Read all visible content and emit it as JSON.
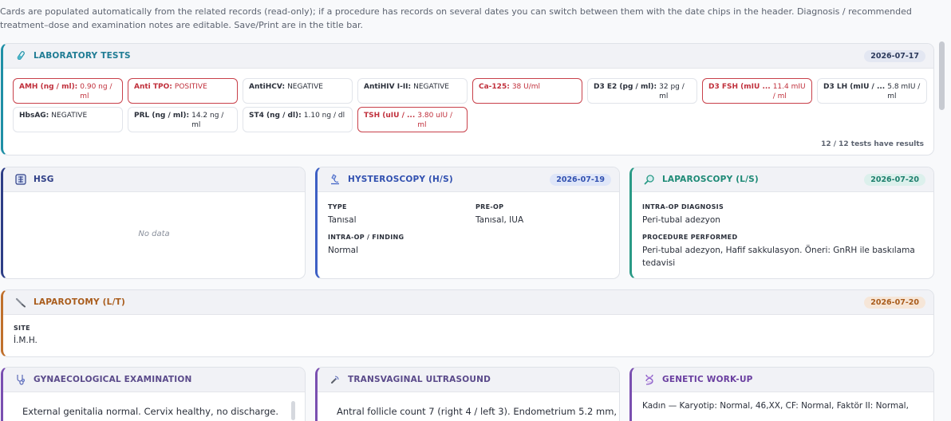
{
  "notice": "Cards are populated automatically from the related records (read-only); if a procedure has records on several dates you can switch between them with the date chips in the header. Diagnosis / recommended treatment–dose and examination notes are editable. Save/Print are in the title bar.",
  "lab": {
    "title": "LABORATORY TESTS",
    "icon": "test-tube-icon",
    "date": "2026-07-17",
    "count_text": "12 / 12 tests have results",
    "tests": [
      {
        "name": "AMH (ng / ml):",
        "value": "0.90 ng / ml",
        "abnormal": true
      },
      {
        "name": "Anti TPO:",
        "value": "POSITIVE",
        "abnormal": true
      },
      {
        "name": "AntiHCV:",
        "value": "NEGATIVE",
        "abnormal": false
      },
      {
        "name": "AntiHIV I-II:",
        "value": "NEGATIVE",
        "abnormal": false
      },
      {
        "name": "Ca-125:",
        "value": "38 U/ml",
        "abnormal": true
      },
      {
        "name": "D3 E2 (pg / ml):",
        "value": "32 pg / ml",
        "abnormal": false
      },
      {
        "name": "D3 FSH (mIU ...",
        "value": "11.4 mIU / ml",
        "abnormal": true
      },
      {
        "name": "D3 LH (mIU / ...",
        "value": "5.8 mIU / ml",
        "abnormal": false
      },
      {
        "name": "HbsAG:",
        "value": "NEGATIVE",
        "abnormal": false
      },
      {
        "name": "PRL (ng / ml):",
        "value": "14.2 ng / ml",
        "abnormal": false
      },
      {
        "name": "ST4 (ng / dl):",
        "value": "1.10 ng / dl",
        "abnormal": false
      },
      {
        "name": "TSH (uIU / ...",
        "value": "3.80 uIU / ml",
        "abnormal": true
      }
    ]
  },
  "hsg": {
    "title": "HSG",
    "icon": "xray-icon",
    "empty": "No data"
  },
  "hysteroscopy": {
    "title": "HYSTEROSCOPY (H/S)",
    "icon": "microscope-icon",
    "date": "2026-07-19",
    "type_label": "TYPE",
    "type_value": "Tanısal",
    "preop_label": "PRE-OP",
    "preop_value": "Tanısal, IUA",
    "finding_label": "INTRA-OP / FINDING",
    "finding_value": "Normal"
  },
  "laparoscopy": {
    "title": "LAPAROSCOPY (L/S)",
    "icon": "magnifier-icon",
    "date": "2026-07-20",
    "diag_label": "INTRA-OP DIAGNOSIS",
    "diag_value": "Peri-tubal adezyon",
    "proc_label": "PROCEDURE PERFORMED",
    "proc_value": "Peri-tubal adezyon, Hafif sakkulasyon. Öneri: GnRH ile baskılama tedavisi"
  },
  "laparotomy": {
    "title": "LAPAROTOMY (L/T)",
    "icon": "scalpel-icon",
    "date": "2026-07-20",
    "site_label": "SITE",
    "site_value": "İ.M.H."
  },
  "gyn": {
    "title": "GYNAECOLOGICAL EXAMINATION",
    "icon": "stethoscope-icon",
    "text": "External genitalia normal. Cervix healthy, no discharge."
  },
  "tvus": {
    "title": "TRANSVAGINAL ULTRASOUND",
    "icon": "ultrasound-icon",
    "text": "Antral follicle count 7 (right 4 / left 3). Endometrium 5.2 mm,"
  },
  "genetic": {
    "title": "GENETIC WORK-UP",
    "icon": "dna-icon",
    "text": "Kadın — Karyotip: Normal, 46,XX, CF: Normal, Faktör II: Normal,"
  }
}
